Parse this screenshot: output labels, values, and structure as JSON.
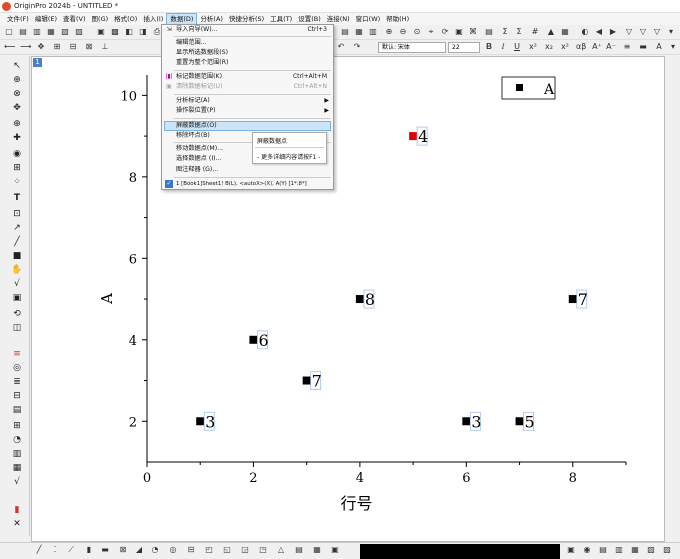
{
  "window": {
    "title": "OriginPro 2024b - UNTITLED *"
  },
  "menu": [
    "文件(F)",
    "编辑(E)",
    "查看(V)",
    "图(G)",
    "格式(O)",
    "插入(I)",
    "数据(D)",
    "分析(A)",
    "快捷分析(S)",
    "工具(T)",
    "设置(B)",
    "连接(N)",
    "窗口(W)",
    "帮助(H)"
  ],
  "toolbar": {
    "font_name": "默认: 宋体",
    "font_size": "22",
    "bold": "B",
    "italic": "I",
    "underline": "U"
  },
  "page_tab": "1",
  "dropdown": {
    "items": [
      {
        "label": "导入向导(W)...",
        "shortcut": "Ctrl+3",
        "disabled": false,
        "submenu": false
      },
      {
        "label": "编辑范围...",
        "shortcut": "",
        "disabled": false,
        "submenu": false
      },
      {
        "label": "显示所选数据段(S)",
        "shortcut": "",
        "disabled": false,
        "submenu": false
      },
      {
        "label": "重置为整个范围(R)",
        "shortcut": "",
        "disabled": false,
        "submenu": false
      },
      {
        "label": "标记数据范围(K)",
        "shortcut": "Ctrl+Alt+M",
        "disabled": false,
        "submenu": false
      },
      {
        "label": "清除数据标记(U)",
        "shortcut": "Ctrl+Alt+N",
        "disabled": true,
        "submenu": false
      },
      {
        "label": "分析标记(A)",
        "shortcut": "",
        "disabled": false,
        "submenu": true
      },
      {
        "label": "操作裂位置(P)",
        "shortcut": "",
        "disabled": false,
        "submenu": true
      },
      {
        "label": "屏蔽数据点(O)",
        "shortcut": "",
        "disabled": false,
        "submenu": false
      },
      {
        "label": "移除坏点(B)",
        "shortcut": "",
        "disabled": false,
        "submenu": false
      },
      {
        "label": "移动数据点(M)...",
        "shortcut": "",
        "disabled": false,
        "submenu": false
      },
      {
        "label": "选择数据点 (I)...",
        "shortcut": "",
        "disabled": false,
        "submenu": false
      },
      {
        "label": "图注释器 (G)...",
        "shortcut": "",
        "disabled": false,
        "submenu": false
      },
      {
        "label": "1   [Book1]Sheet1! B(L), <autoX>(X), A(Y) [1*:8*]",
        "shortcut": "",
        "disabled": false,
        "submenu": false
      }
    ]
  },
  "tooltip": {
    "title": "屏蔽数据点",
    "hint": "- 更多详细内容请按F1 -"
  },
  "chart_data": {
    "type": "scatter",
    "xlabel": "行号",
    "ylabel": "A",
    "xlim": [
      0,
      9
    ],
    "ylim": [
      1,
      10.5
    ],
    "x_ticks": [
      "0",
      "2",
      "4",
      "6",
      "8"
    ],
    "y_ticks": [
      "2",
      "4",
      "6",
      "8",
      "10"
    ],
    "legend": {
      "label": "A",
      "placement": "top-right"
    },
    "points": [
      {
        "x": 1,
        "y": 2,
        "label": "3",
        "color": "#000000"
      },
      {
        "x": 2,
        "y": 4,
        "label": "6",
        "color": "#000000"
      },
      {
        "x": 3,
        "y": 3,
        "label": "7",
        "color": "#000000"
      },
      {
        "x": 4,
        "y": 5,
        "label": "8",
        "color": "#000000"
      },
      {
        "x": 5,
        "y": 9,
        "label": "4",
        "color": "#e00000"
      },
      {
        "x": 6,
        "y": 2,
        "label": "3",
        "color": "#000000"
      },
      {
        "x": 7,
        "y": 2,
        "label": "5",
        "color": "#000000"
      },
      {
        "x": 8,
        "y": 5,
        "label": "7",
        "color": "#000000"
      }
    ]
  }
}
